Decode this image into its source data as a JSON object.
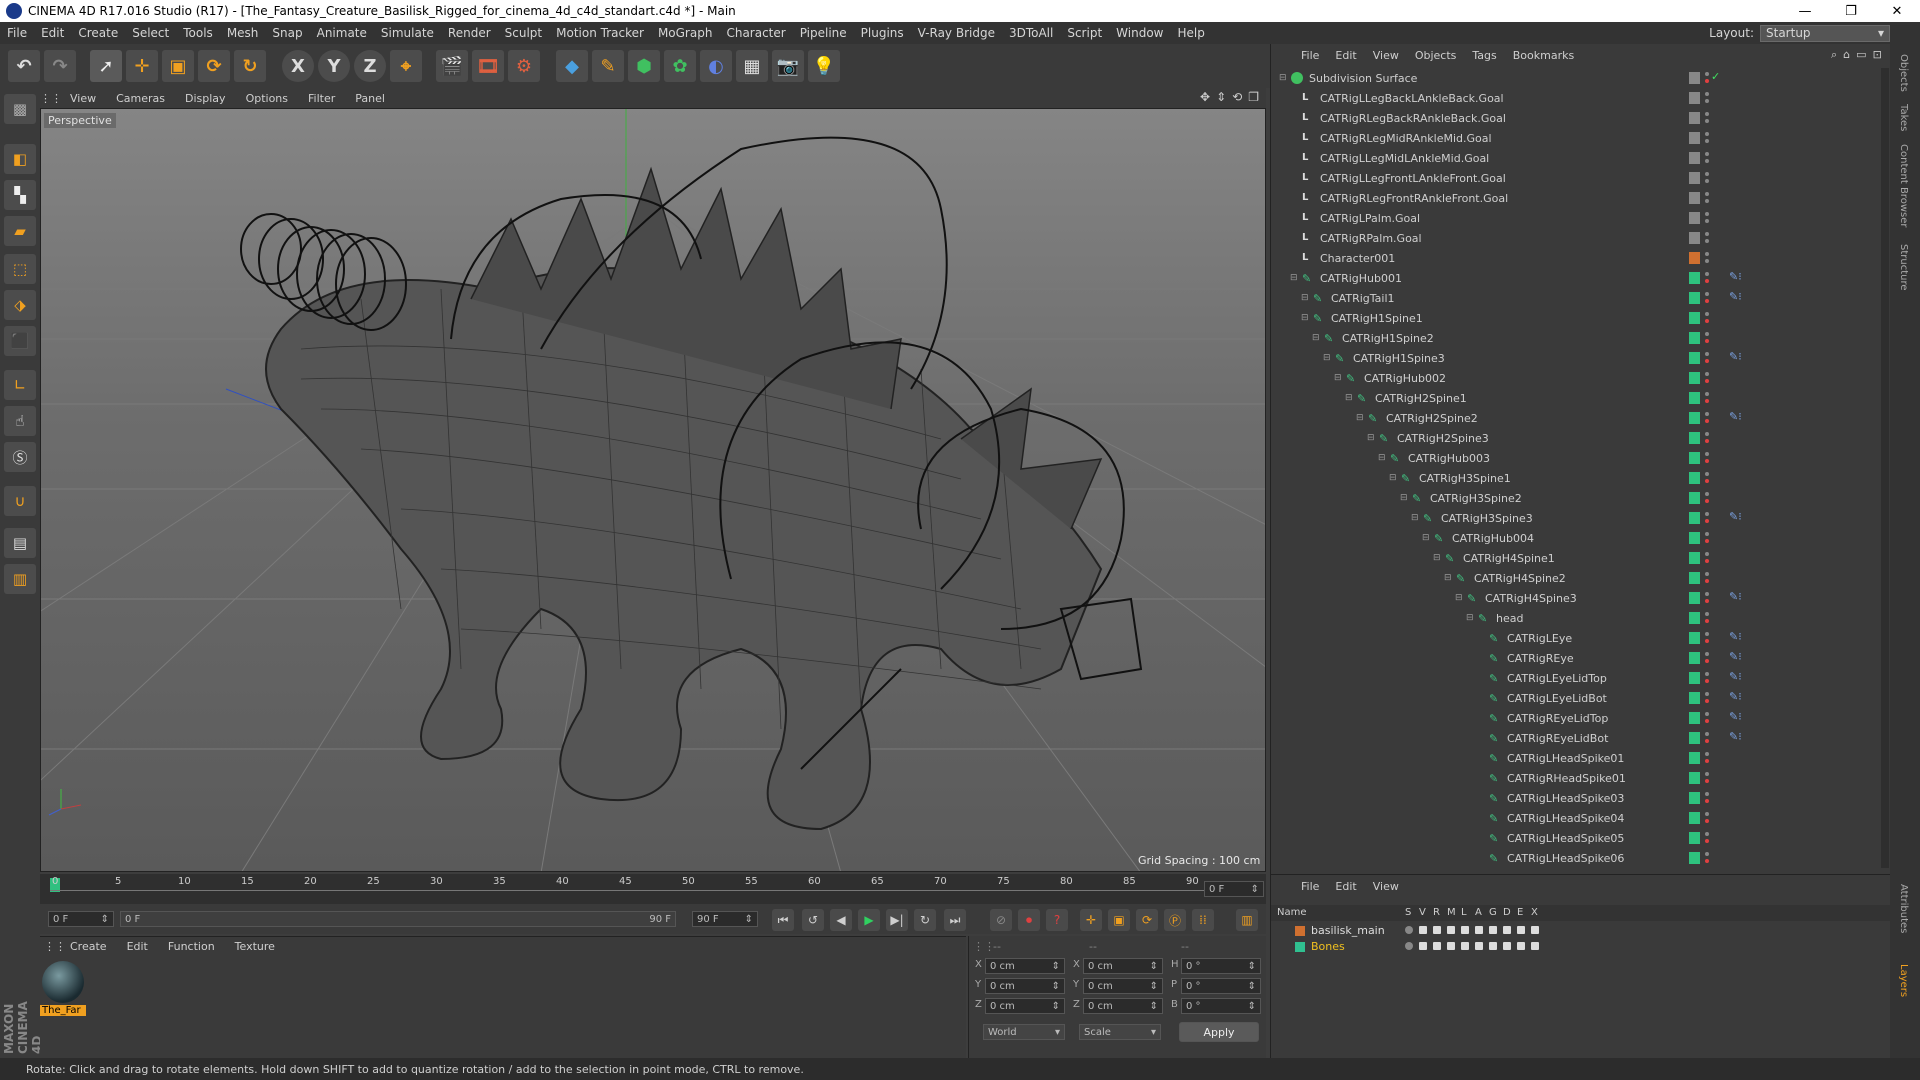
{
  "window": {
    "title": "CINEMA 4D R17.016 Studio (R17) - [The_Fantasy_Creature_Basilisk_Rigged_for_cinema_4d_c4d_standart.c4d *] - Main",
    "controls": [
      "—",
      "❐",
      "✕"
    ]
  },
  "menubar": [
    "File",
    "Edit",
    "Create",
    "Select",
    "Tools",
    "Mesh",
    "Snap",
    "Animate",
    "Simulate",
    "Render",
    "Sculpt",
    "Motion Tracker",
    "MoGraph",
    "Character",
    "Pipeline",
    "Plugins",
    "V-Ray Bridge",
    "3DToAll",
    "Script",
    "Window",
    "Help"
  ],
  "layout": {
    "label": "Layout:",
    "value": "Startup"
  },
  "toolbar": {
    "axis_x": "X",
    "axis_y": "Y",
    "axis_z": "Z",
    "icons": [
      "undo-icon",
      "redo-icon",
      "select-icon",
      "move-icon",
      "scale-icon",
      "rotate-icon",
      "recent-icon",
      "axis-x",
      "axis-y",
      "axis-z",
      "coord-system-icon",
      "render-view-icon",
      "render-picture-icon",
      "render-settings-icon",
      "cube-icon",
      "pen-icon",
      "subdivision-icon",
      "array-icon",
      "deformer-icon",
      "floor-icon",
      "camera-icon",
      "light-icon"
    ]
  },
  "viewport": {
    "menu": [
      "View",
      "Cameras",
      "Display",
      "Options",
      "Filter",
      "Panel"
    ],
    "label": "Perspective",
    "grid_spacing": "Grid Spacing : 100 cm"
  },
  "timeline": {
    "ticks": [
      "0",
      "5",
      "10",
      "15",
      "20",
      "25",
      "30",
      "35",
      "40",
      "45",
      "50",
      "55",
      "60",
      "65",
      "70",
      "75",
      "80",
      "85",
      "90"
    ],
    "current_frame": "0 F",
    "start": "0 F",
    "range_start": "0 F",
    "range_end": "90 F",
    "end": "90 F"
  },
  "material_manager": {
    "menu": [
      "Create",
      "Edit",
      "Function",
      "Texture"
    ],
    "material_label": "The_Far"
  },
  "coordinates": {
    "headers": [
      "--",
      "--",
      "--"
    ],
    "rows": [
      {
        "axis": "X",
        "pos": "0 cm",
        "size_axis": "X",
        "size": "0 cm",
        "rot_axis": "H",
        "rot": "0 °"
      },
      {
        "axis": "Y",
        "pos": "0 cm",
        "size_axis": "Y",
        "size": "0 cm",
        "rot_axis": "P",
        "rot": "0 °"
      },
      {
        "axis": "Z",
        "pos": "0 cm",
        "size_axis": "Z",
        "size": "0 cm",
        "rot_axis": "B",
        "rot": "0 °"
      }
    ],
    "mode": "World",
    "scale": "Scale",
    "apply": "Apply"
  },
  "object_manager": {
    "menu": [
      "File",
      "Edit",
      "View",
      "Objects",
      "Tags",
      "Bookmarks"
    ],
    "objects": [
      {
        "name": "Subdivision Surface",
        "depth": 0,
        "type": "subdiv"
      },
      {
        "name": "CATRigLLegBackLAnkleBack.Goal",
        "depth": 1,
        "type": "null"
      },
      {
        "name": "CATRigRLegBackRAnkleBack.Goal",
        "depth": 1,
        "type": "null"
      },
      {
        "name": "CATRigRLegMidRAnkleMid.Goal",
        "depth": 1,
        "type": "null"
      },
      {
        "name": "CATRigLLegMidLAnkleMid.Goal",
        "depth": 1,
        "type": "null"
      },
      {
        "name": "CATRigLLegFrontLAnkleFront.Goal",
        "depth": 1,
        "type": "null"
      },
      {
        "name": "CATRigRLegFrontRAnkleFront.Goal",
        "depth": 1,
        "type": "null"
      },
      {
        "name": "CATRigLPalm.Goal",
        "depth": 1,
        "type": "null"
      },
      {
        "name": "CATRigRPalm.Goal",
        "depth": 1,
        "type": "null"
      },
      {
        "name": "Character001",
        "depth": 1,
        "type": "null"
      },
      {
        "name": "CATRigHub001",
        "depth": 1,
        "type": "bone"
      },
      {
        "name": "CATRigTail1",
        "depth": 2,
        "type": "bone"
      },
      {
        "name": "CATRigH1Spine1",
        "depth": 2,
        "type": "bone"
      },
      {
        "name": "CATRigH1Spine2",
        "depth": 3,
        "type": "bone"
      },
      {
        "name": "CATRigH1Spine3",
        "depth": 4,
        "type": "bone"
      },
      {
        "name": "CATRigHub002",
        "depth": 5,
        "type": "bone"
      },
      {
        "name": "CATRigH2Spine1",
        "depth": 6,
        "type": "bone"
      },
      {
        "name": "CATRigH2Spine2",
        "depth": 7,
        "type": "bone"
      },
      {
        "name": "CATRigH2Spine3",
        "depth": 8,
        "type": "bone"
      },
      {
        "name": "CATRigHub003",
        "depth": 9,
        "type": "bone"
      },
      {
        "name": "CATRigH3Spine1",
        "depth": 10,
        "type": "bone"
      },
      {
        "name": "CATRigH3Spine2",
        "depth": 11,
        "type": "bone"
      },
      {
        "name": "CATRigH3Spine3",
        "depth": 12,
        "type": "bone"
      },
      {
        "name": "CATRigHub004",
        "depth": 13,
        "type": "bone"
      },
      {
        "name": "CATRigH4Spine1",
        "depth": 14,
        "type": "bone"
      },
      {
        "name": "CATRigH4Spine2",
        "depth": 15,
        "type": "bone"
      },
      {
        "name": "CATRigH4Spine3",
        "depth": 16,
        "type": "bone"
      },
      {
        "name": "head",
        "depth": 17,
        "type": "bone"
      },
      {
        "name": "CATRigLEye",
        "depth": 18,
        "type": "bone"
      },
      {
        "name": "CATRigREye",
        "depth": 18,
        "type": "bone"
      },
      {
        "name": "CATRigLEyeLidTop",
        "depth": 18,
        "type": "bone"
      },
      {
        "name": "CATRigLEyeLidBot",
        "depth": 18,
        "type": "bone"
      },
      {
        "name": "CATRigREyeLidTop",
        "depth": 18,
        "type": "bone"
      },
      {
        "name": "CATRigREyeLidBot",
        "depth": 18,
        "type": "bone"
      },
      {
        "name": "CATRigLHeadSpike01",
        "depth": 18,
        "type": "bone"
      },
      {
        "name": "CATRigRHeadSpike01",
        "depth": 18,
        "type": "bone"
      },
      {
        "name": "CATRigLHeadSpike03",
        "depth": 18,
        "type": "bone"
      },
      {
        "name": "CATRigLHeadSpike04",
        "depth": 18,
        "type": "bone"
      },
      {
        "name": "CATRigLHeadSpike05",
        "depth": 18,
        "type": "bone"
      },
      {
        "name": "CATRigLHeadSpike06",
        "depth": 18,
        "type": "bone"
      }
    ]
  },
  "layer_manager": {
    "menu": [
      "File",
      "Edit",
      "View"
    ],
    "columns": [
      "Name",
      "S",
      "V",
      "R",
      "M",
      "L",
      "A",
      "G",
      "D",
      "E",
      "X"
    ],
    "layers": [
      {
        "name": "basilisk_main",
        "color": "#d07030"
      },
      {
        "name": "Bones",
        "color": "#30c090"
      }
    ]
  },
  "right_tabs": [
    "Objects",
    "Takes",
    "Content Browser",
    "Structure",
    "Attributes",
    "Layers"
  ],
  "brand": "MAXON CINEMA 4D",
  "status": "Rotate: Click and drag to rotate elements. Hold down SHIFT to add to quantize rotation / add to the selection in point mode, CTRL to remove.",
  "colors": {
    "accent": "#f0a020",
    "layer_green": "#2ec27e",
    "selected": "#f0c020"
  }
}
